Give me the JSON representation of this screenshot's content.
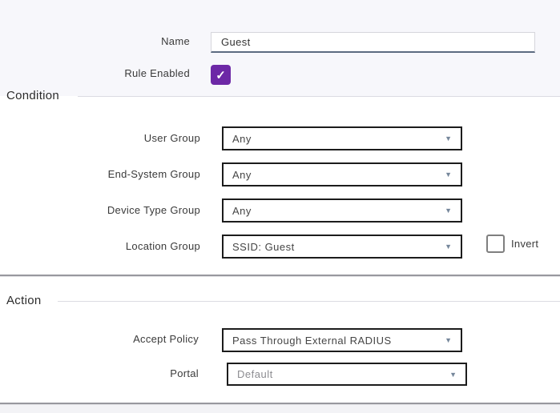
{
  "form": {
    "name_row": {
      "label": "Name",
      "value": "Guest"
    },
    "rule_enabled_row": {
      "label": "Rule Enabled",
      "checked": true
    },
    "condition": {
      "title": "Condition",
      "rows": [
        {
          "label": "User Group",
          "value": "Any"
        },
        {
          "label": "End-System Group",
          "value": "Any"
        },
        {
          "label": "Device Type Group",
          "value": "Any"
        },
        {
          "label": "Location Group",
          "value": "SSID: Guest"
        }
      ],
      "invert": {
        "label": "Invert",
        "checked": false
      }
    },
    "action": {
      "title": "Action",
      "rows": [
        {
          "label": "Accept Policy",
          "value": "Pass Through External RADIUS"
        },
        {
          "label": "Portal",
          "value": "Default",
          "disabled": true
        }
      ]
    },
    "icons": {
      "dropdown_arrow": "▼",
      "checkmark": "✓"
    },
    "colors": {
      "accent_purple": "#6D28A6",
      "dropdown_border": "#1C1C1C",
      "arrow_blue_gray": "#76879B",
      "page_tint": "#F7F7FB"
    }
  }
}
